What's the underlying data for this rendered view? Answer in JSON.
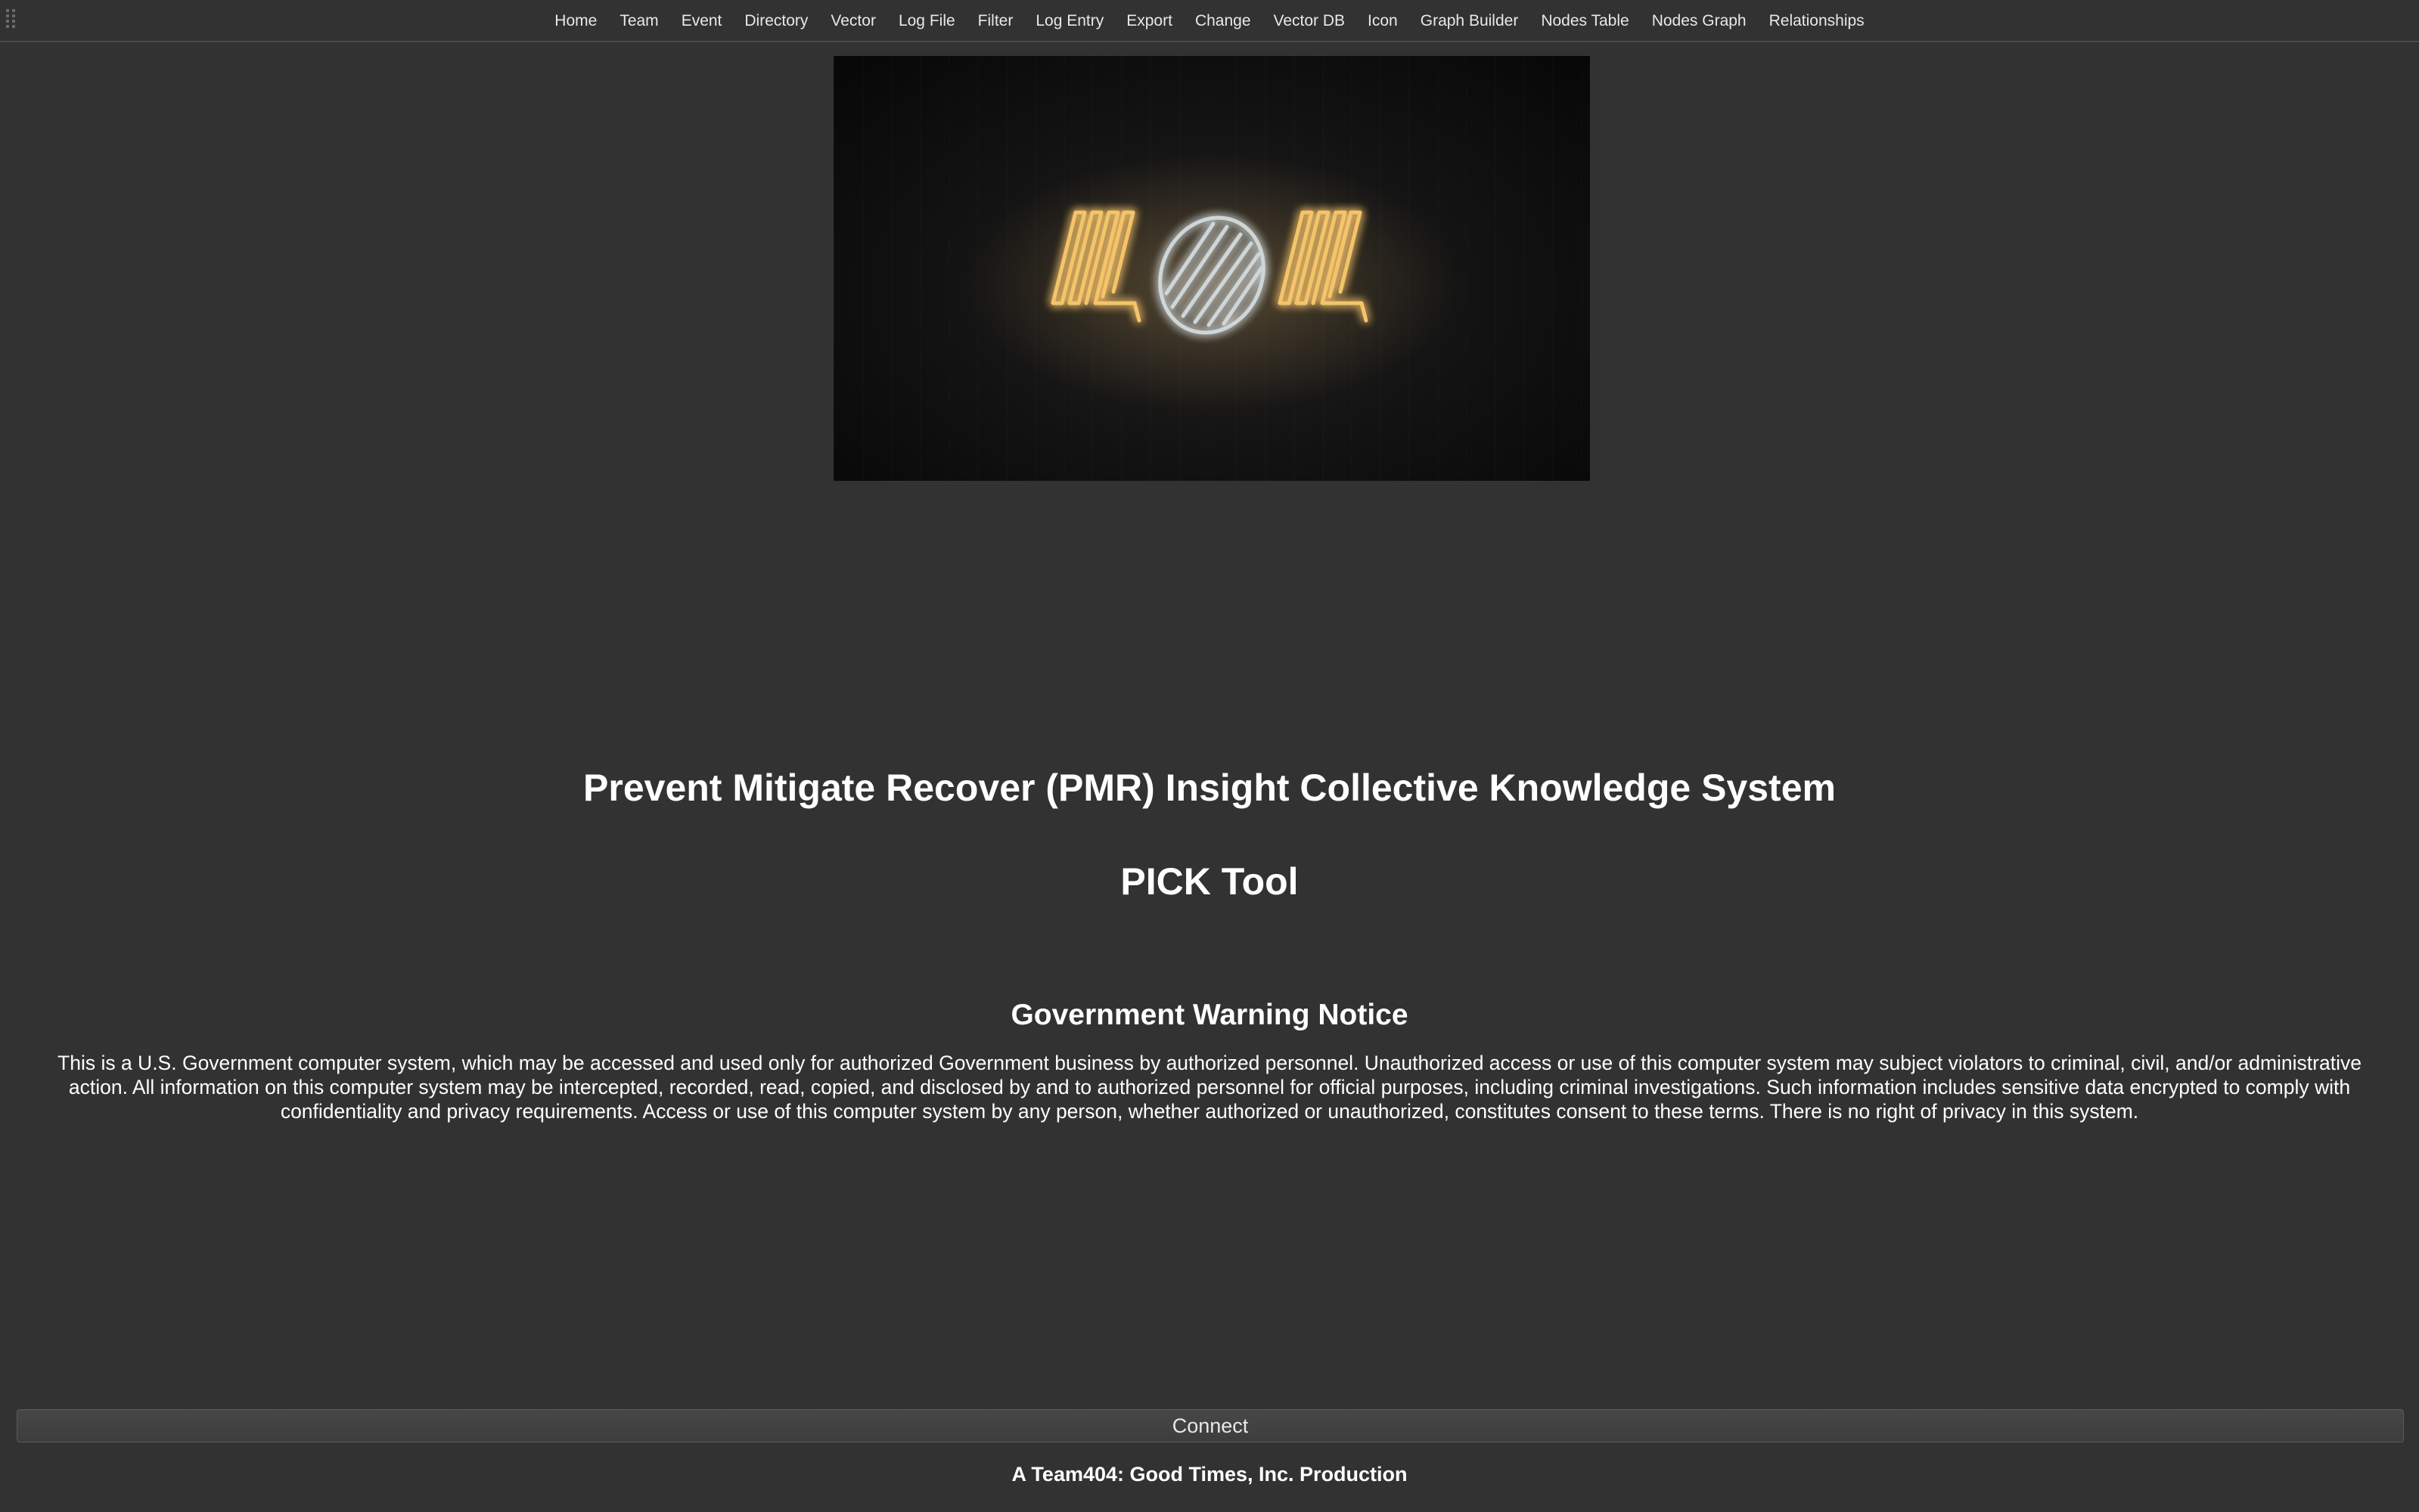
{
  "toolbar": {
    "items": [
      {
        "label": "Home"
      },
      {
        "label": "Team"
      },
      {
        "label": "Event"
      },
      {
        "label": "Directory"
      },
      {
        "label": "Vector"
      },
      {
        "label": "Log File"
      },
      {
        "label": "Filter"
      },
      {
        "label": "Log Entry"
      },
      {
        "label": "Export"
      },
      {
        "label": "Change"
      },
      {
        "label": "Vector DB"
      },
      {
        "label": "Icon"
      },
      {
        "label": "Graph Builder"
      },
      {
        "label": "Nodes Table"
      },
      {
        "label": "Nodes Graph"
      },
      {
        "label": "Relationships"
      }
    ]
  },
  "hero": {
    "logo_text": "404",
    "colors": {
      "neon_warm": "#f5c46a",
      "neon_cool": "#cfd6d8",
      "background": "#0b0b0b"
    }
  },
  "main": {
    "title": "Prevent Mitigate Recover (PMR) Insight Collective Knowledge System",
    "subtitle": "PICK Tool",
    "notice_title": "Government Warning Notice",
    "notice_body": "This is a U.S. Government computer system, which may be accessed and used only for authorized Government business by authorized personnel. Unauthorized access or use of this computer system may subject violators to criminal, civil, and/or administrative action. All information on this computer system may be intercepted, recorded, read, copied, and disclosed by and to authorized personnel for official purposes, including criminal investigations. Such information includes sensitive data encrypted to comply with confidentiality and privacy requirements. Access or use of this computer system by any person, whether authorized or unauthorized, constitutes consent to these terms. There is no right of privacy in this system."
  },
  "actions": {
    "connect_label": "Connect"
  },
  "footer": {
    "credit": "A Team404: Good Times, Inc. Production"
  },
  "colors": {
    "background": "#323232",
    "text": "#ffffff",
    "button": "#434343"
  }
}
